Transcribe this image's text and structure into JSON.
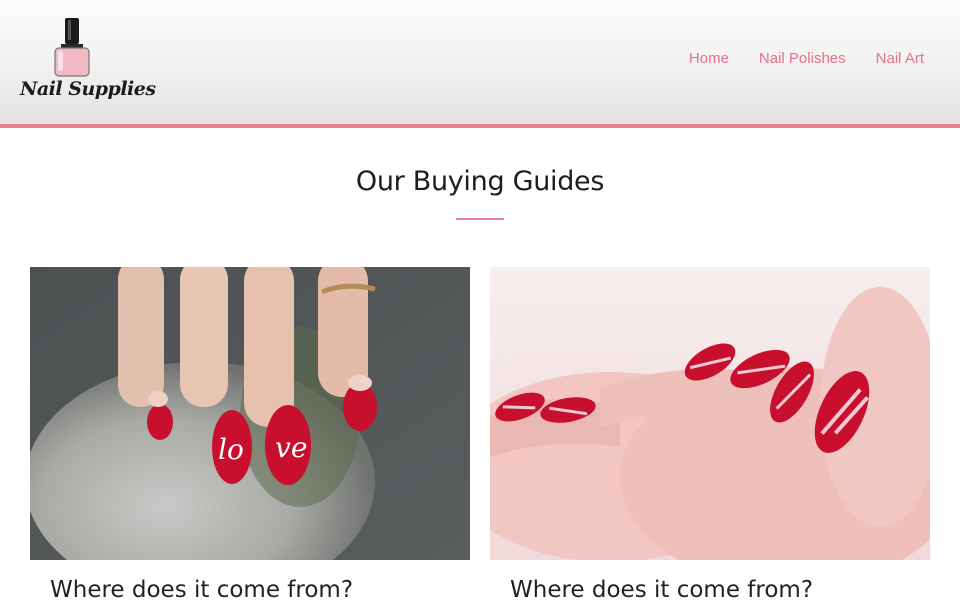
{
  "brand": {
    "logo_text": "Nail Supplies"
  },
  "nav": {
    "items": [
      "Home",
      "Nail Polishes",
      "Nail Art"
    ]
  },
  "colors": {
    "accent": "#ea7f94",
    "nav_text": "#e8708a",
    "nail_red": "#c8102e"
  },
  "section": {
    "title": "Our Buying Guides"
  },
  "cards": [
    {
      "title": "Where does it come from?",
      "image": "nail-art-love-photo"
    },
    {
      "title": "Where does it come from?",
      "image": "striped-red-nails-photo"
    }
  ]
}
